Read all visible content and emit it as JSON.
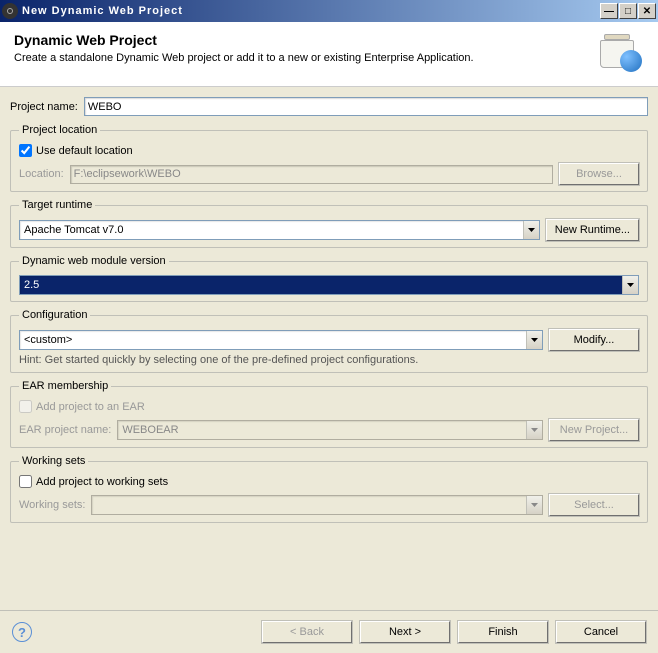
{
  "window": {
    "title": "New Dynamic Web Project"
  },
  "header": {
    "title": "Dynamic Web Project",
    "description": "Create a standalone Dynamic Web project or add it to a new or existing Enterprise Application."
  },
  "project_name": {
    "label": "Project name:",
    "value": "WEBO"
  },
  "location": {
    "legend": "Project location",
    "checkbox_label": "Use default location",
    "checked": true,
    "path_label": "Location:",
    "path_value": "F:\\eclipsework\\WEBO",
    "browse": "Browse..."
  },
  "runtime": {
    "legend": "Target runtime",
    "value": "Apache Tomcat v7.0",
    "button": "New Runtime..."
  },
  "module_version": {
    "legend": "Dynamic web module version",
    "value": "2.5"
  },
  "configuration": {
    "legend": "Configuration",
    "value": "<custom>",
    "button": "Modify...",
    "hint": "Hint: Get started quickly by selecting one of the pre-defined project configurations."
  },
  "ear": {
    "legend": "EAR membership",
    "checkbox_label": "Add project to an EAR",
    "checked": false,
    "name_label": "EAR project name:",
    "name_value": "WEBOEAR",
    "button": "New Project..."
  },
  "working_sets": {
    "legend": "Working sets",
    "checkbox_label": "Add project to working sets",
    "checked": false,
    "label": "Working sets:",
    "value": "",
    "button": "Select..."
  },
  "footer": {
    "back": "< Back",
    "next": "Next >",
    "finish": "Finish",
    "cancel": "Cancel"
  }
}
